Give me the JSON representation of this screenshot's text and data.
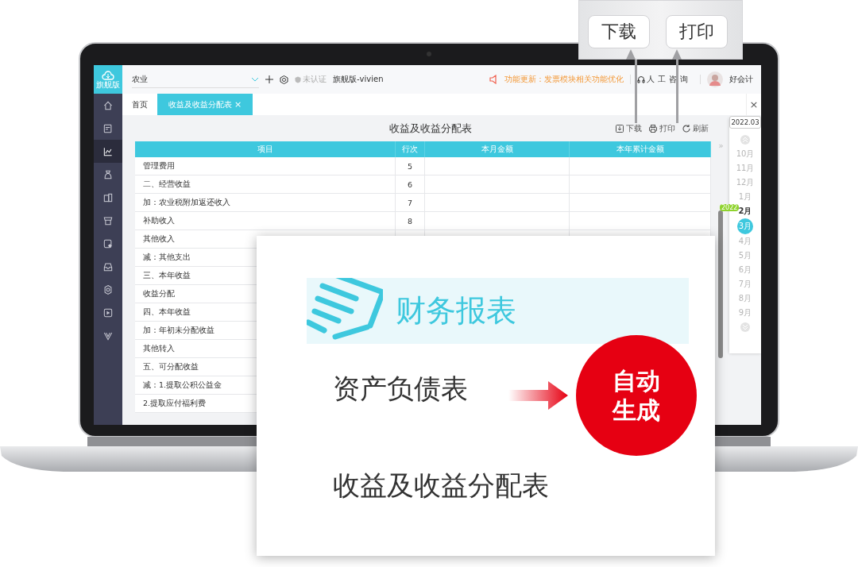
{
  "app": {
    "logo_label": "旗舰版"
  },
  "sidebar": {
    "items": [
      {
        "selected": false
      },
      {
        "selected": false
      },
      {
        "selected": true
      },
      {
        "selected": false
      },
      {
        "selected": false
      },
      {
        "selected": false
      },
      {
        "selected": false
      },
      {
        "selected": false
      },
      {
        "selected": false
      },
      {
        "selected": false
      },
      {
        "selected": false
      }
    ]
  },
  "topbar": {
    "company_field": {
      "value": "农业"
    },
    "verify_status": "未认证",
    "edition": "旗舰版-vivien",
    "notice": "功能更新：发票模块相关功能优化",
    "support": "人工咨询",
    "user": "好会计"
  },
  "tabs": [
    {
      "label": "首页",
      "selected": false
    },
    {
      "label": "收益及收益分配表",
      "selected": true,
      "close": "×"
    }
  ],
  "tab_bar_close": "×",
  "report": {
    "title": "收益及收益分配表",
    "actions": [
      {
        "kind": "download",
        "label": "下载"
      },
      {
        "kind": "print",
        "label": "打印"
      },
      {
        "kind": "refresh",
        "label": "刷新"
      }
    ]
  },
  "table": {
    "columns": [
      "项目",
      "行次",
      "本月金额",
      "本年累计金额"
    ],
    "rows": [
      {
        "item": "管理费用",
        "line": "5"
      },
      {
        "item": "二、经营收益",
        "line": "6"
      },
      {
        "item": "加：农业税附加返还收入",
        "line": "7"
      },
      {
        "item": "补助收入",
        "line": "8"
      },
      {
        "item": "其他收入"
      },
      {
        "item": "减：其他支出"
      },
      {
        "item": "三、本年收益"
      },
      {
        "item": "收益分配"
      },
      {
        "item": "四、本年收益"
      },
      {
        "item": "加：年初未分配收益"
      },
      {
        "item": "其他转入"
      },
      {
        "item": "五、可分配收益"
      },
      {
        "item": "减：1.提取公积公益金"
      },
      {
        "item": "2.提取应付福利费"
      }
    ]
  },
  "date_picker": {
    "value": "2022.03",
    "expand": "»",
    "year_badge": "2022",
    "months": [
      {
        "label": "10月",
        "selected": false,
        "current": false
      },
      {
        "label": "11月",
        "selected": false,
        "current": false
      },
      {
        "label": "12月",
        "selected": false,
        "current": false
      },
      {
        "label": "1月",
        "selected": false,
        "current": false
      },
      {
        "label": "2月",
        "selected": false,
        "current": true
      },
      {
        "label": "3月",
        "selected": true,
        "current": false
      },
      {
        "label": "4月",
        "selected": false,
        "current": false
      },
      {
        "label": "5月",
        "selected": false,
        "current": false
      },
      {
        "label": "6月",
        "selected": false,
        "current": false
      },
      {
        "label": "7月",
        "selected": false,
        "current": false
      },
      {
        "label": "8月",
        "selected": false,
        "current": false
      },
      {
        "label": "9月",
        "selected": false,
        "current": false
      }
    ]
  },
  "callout": {
    "buttons": [
      "下载",
      "打印"
    ]
  },
  "feature_card": {
    "banner": "财务报表",
    "reports": [
      "资产负债表",
      "收益及收益分配表"
    ],
    "badge": [
      "自动",
      "生成"
    ]
  }
}
